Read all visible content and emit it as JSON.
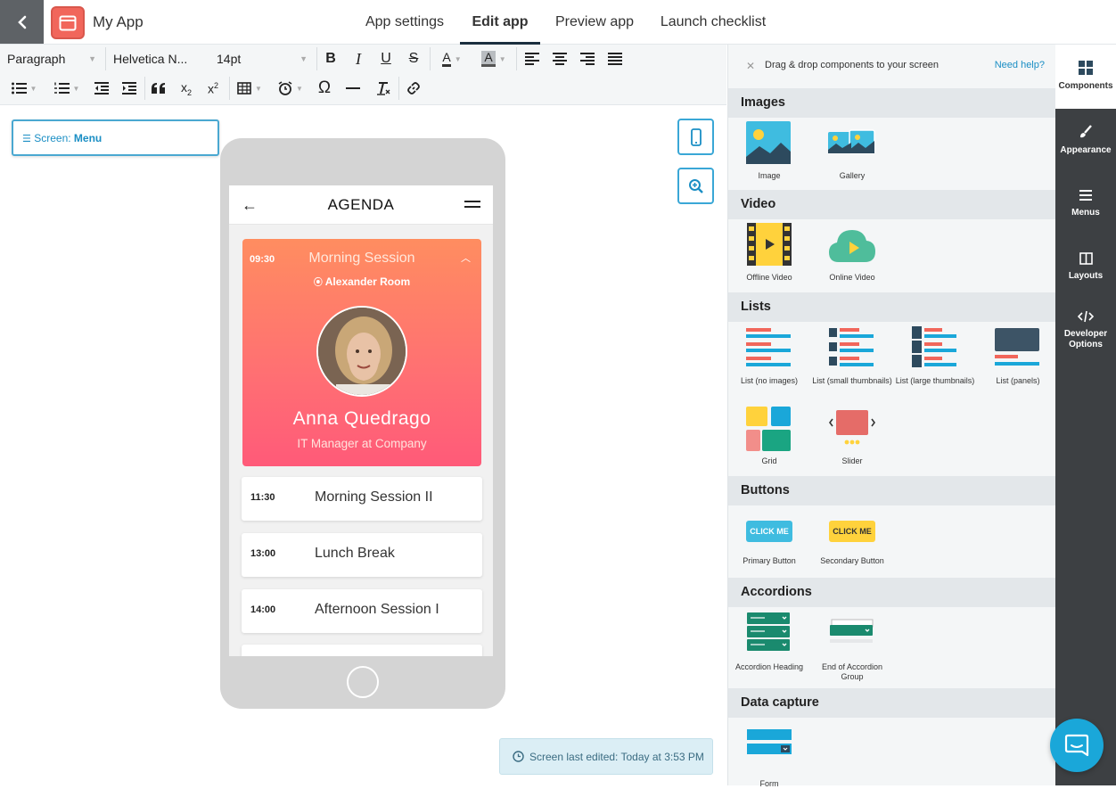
{
  "app": {
    "name": "My App"
  },
  "nav": {
    "tabs": [
      "App settings",
      "Edit app",
      "Preview app",
      "Launch checklist"
    ],
    "active": "Edit app"
  },
  "toolbar": {
    "block_format": "Paragraph",
    "font_family": "Helvetica N...",
    "font_size": "14pt",
    "bold": "B",
    "italic": "I",
    "underline": "U",
    "strike": "S",
    "text_color": "A",
    "bg_color": "A",
    "omega": "Ω",
    "quote": "66"
  },
  "canvas": {
    "screen_label_prefix": "Screen: ",
    "screen_label_name": "Menu",
    "last_edited": "Screen last edited: Today at 3:53 PM"
  },
  "phone": {
    "header_title": "AGENDA",
    "featured": {
      "time": "09:30",
      "title": "Morning Session",
      "room": "Alexander Room",
      "speaker": "Anna Quedrago",
      "role": "IT Manager at Company"
    },
    "sessions": [
      {
        "time": "11:30",
        "name": "Morning Session II"
      },
      {
        "time": "13:00",
        "name": "Lunch Break"
      },
      {
        "time": "14:00",
        "name": "Afternoon Session I"
      }
    ]
  },
  "panel": {
    "hint": "Drag & drop components to your screen",
    "help": "Need help?",
    "sections": [
      {
        "title": "Images",
        "items": [
          "Image",
          "Gallery"
        ]
      },
      {
        "title": "Video",
        "items": [
          "Offline Video",
          "Online Video"
        ]
      },
      {
        "title": "Lists",
        "items": [
          "List (no images)",
          "List (small thumbnails)",
          "List (large thumbnails)",
          "List (panels)",
          "Grid",
          "Slider"
        ]
      },
      {
        "title": "Buttons",
        "items": [
          "Primary Button",
          "Secondary Button"
        ]
      },
      {
        "title": "Accordions",
        "items": [
          "Accordion Heading",
          "End of Accordion Group"
        ]
      },
      {
        "title": "Data capture",
        "items": [
          "Form"
        ]
      }
    ],
    "button_preview_text": "CLICK ME"
  },
  "rail": {
    "items": [
      "Components",
      "Appearance",
      "Menus",
      "Layouts",
      "Developer Options"
    ],
    "active": "Components"
  },
  "colors": {
    "accent": "#1a8ec4",
    "app_icon": "#f1665b",
    "card_gradient_top": "#ff8d60",
    "card_gradient_bottom": "#ff5a79",
    "rail_bg": "#3d4043",
    "chat_button": "#1aa7d9"
  },
  "icons": {
    "back": "chevron-left-icon",
    "app": "browser-window-icon",
    "mobile": "mobile-phone-icon",
    "zoom": "zoom-in-icon",
    "chat": "chat-bubble-icon"
  }
}
